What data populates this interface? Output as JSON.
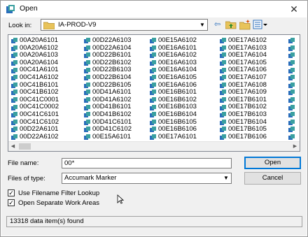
{
  "window": {
    "title": "Open",
    "close_glyph": "✕"
  },
  "lookin": {
    "label": "Look in:",
    "value": "IA-PROD-V9"
  },
  "toolbar": {
    "back_glyph": "⇦",
    "up_glyph": "↑",
    "newfolder_glyph": "✱",
    "view_glyph": "▤"
  },
  "files": {
    "columns": [
      [
        "00A20A6101",
        "00A20A6102",
        "00A20A6103",
        "00A20A6104",
        "00C41A6101",
        "00C41A6102",
        "00C41B6101",
        "00C41B6102",
        "00C41C0001",
        "00C41C0002",
        "00C41C6101",
        "00C41C6102",
        "00D22A6101",
        "00D22A6102"
      ],
      [
        "00D22A6103",
        "00D22A6104",
        "00D22B6101",
        "00D22B6102",
        "00D22B6103",
        "00D22B6104",
        "00D22B6105",
        "00D41A6101",
        "00D41A6102",
        "00D41B6101",
        "00D41B6102",
        "00D41C6101",
        "00D41C6102",
        "00E15A6101"
      ],
      [
        "00E15A6102",
        "00E16A6101",
        "00E16A6102",
        "00E16A6103",
        "00E16A6104",
        "00E16A6105",
        "00E16A6106",
        "00E16B6101",
        "00E16B6102",
        "00E16B6103",
        "00E16B6104",
        "00E16B6105",
        "00E16B6106",
        "00E17A6101"
      ],
      [
        "00E17A6102",
        "00E17A6103",
        "00E17A6104",
        "00E17A6105",
        "00E17A6106",
        "00E17A6107",
        "00E17A6108",
        "00E17A6109",
        "00E17B6101",
        "00E17B6102",
        "00E17B6103",
        "00E17B6104",
        "00E17B6105",
        "00E17B6106"
      ]
    ]
  },
  "filename": {
    "label": "File name:",
    "value": "00*"
  },
  "filetype": {
    "label": "Files of type:",
    "value": "Accumark Marker"
  },
  "buttons": {
    "open": "Open",
    "cancel": "Cancel"
  },
  "options": [
    {
      "label": "Use Filename Filter Lookup",
      "checked": true
    },
    {
      "label": "Open Separate Work Areas",
      "checked": true
    }
  ],
  "status": "13318 data item(s) found",
  "colors": {
    "accent": "#0078d7",
    "file_icon_blue": "#2a6ebb",
    "file_icon_teal": "#3aa0a0"
  }
}
